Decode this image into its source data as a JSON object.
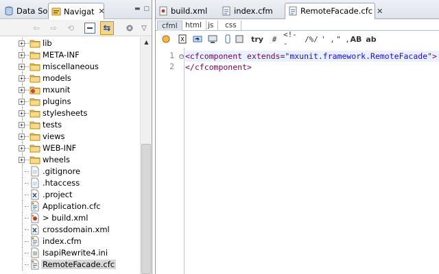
{
  "left_pane": {
    "tabs": [
      {
        "label": "Data So"
      },
      {
        "label": "Navigat",
        "close": "✕"
      }
    ],
    "tree": [
      {
        "label": "lib",
        "type": "folder",
        "expander": "+"
      },
      {
        "label": "META-INF",
        "type": "folder",
        "expander": "+"
      },
      {
        "label": "miscellaneous",
        "type": "folder",
        "expander": "+"
      },
      {
        "label": "models",
        "type": "folder",
        "expander": "+"
      },
      {
        "label": "mxunit",
        "type": "folder-special",
        "expander": "+"
      },
      {
        "label": "plugins",
        "type": "folder",
        "expander": "+"
      },
      {
        "label": "stylesheets",
        "type": "folder",
        "expander": "+"
      },
      {
        "label": "tests",
        "type": "folder",
        "expander": "+"
      },
      {
        "label": "views",
        "type": "folder",
        "expander": "+"
      },
      {
        "label": "WEB-INF",
        "type": "folder",
        "expander": "+"
      },
      {
        "label": "wheels",
        "type": "folder",
        "expander": "+"
      },
      {
        "label": ".gitignore",
        "type": "file"
      },
      {
        "label": ".htaccess",
        "type": "file"
      },
      {
        "label": ".project",
        "type": "xml"
      },
      {
        "label": "Application.cfc",
        "type": "cf"
      },
      {
        "label": "> build.xml",
        "type": "ant"
      },
      {
        "label": "crossdomain.xml",
        "type": "xml"
      },
      {
        "label": "index.cfm",
        "type": "cf"
      },
      {
        "label": "IsapiRewrite4.ini",
        "type": "ini"
      },
      {
        "label": "RemoteFacade.cfc",
        "type": "cf",
        "selected": true
      }
    ]
  },
  "editor": {
    "tabs": [
      {
        "label": "build.xml",
        "close": "✕"
      },
      {
        "label": "index.cfm",
        "close": "✕"
      },
      {
        "label": "RemoteFacade.cfc",
        "close": "✕",
        "active": true
      }
    ],
    "lang_tabs": [
      "cfml",
      "html",
      "js",
      "css"
    ],
    "toolbar": {
      "try": "try",
      "hash": "#",
      "comment": "<!--",
      "cfcomment": "/%/",
      "squote": "' ,",
      "dquote": "\" ,",
      "upper": "AB",
      "lower": "ab"
    },
    "lines": [
      {
        "number": "1",
        "tag_open": "<cfcomponent",
        "attr": " extends=",
        "value": "\"mxunit.framework.RemoteFacade\"",
        "tag_close": ">"
      },
      {
        "number": "2",
        "tag_open": "</cfcomponent>"
      }
    ]
  },
  "colors": {
    "tag": "#7f0055",
    "string": "#2a00ff",
    "current_line": "#e8f2fe",
    "folder": "#e9c46a"
  }
}
